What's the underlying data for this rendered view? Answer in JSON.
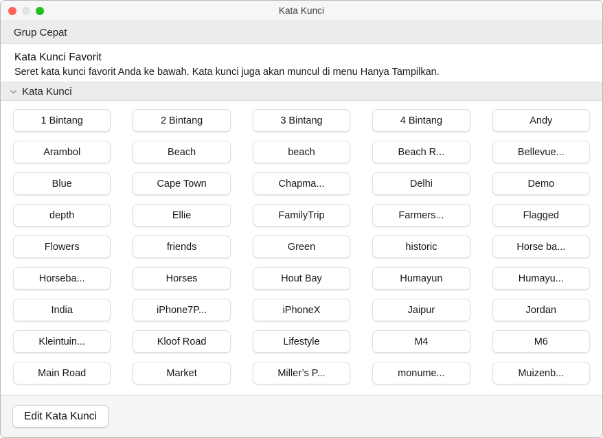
{
  "window": {
    "title": "Kata Kunci",
    "traffic_lights": [
      {
        "name": "close",
        "color": "#ff6159"
      },
      {
        "name": "minimize",
        "color": "#e4e4e4"
      },
      {
        "name": "zoom",
        "color": "#1ec11e"
      }
    ]
  },
  "quick_group": {
    "label": "Grup Cepat"
  },
  "favorites": {
    "title": "Kata Kunci Favorit",
    "description": "Seret kata kunci favorit Anda ke bawah. Kata kunci juga akan muncul di menu Hanya Tampilkan."
  },
  "disclosure": {
    "label": "Kata Kunci",
    "icon": "chevron-down-icon",
    "expanded": true
  },
  "keywords": [
    "1 Bintang",
    "2 Bintang",
    "3 Bintang",
    "4 Bintang",
    "Andy",
    "Arambol",
    "Beach",
    "beach",
    "Beach R...",
    "Bellevue...",
    "Blue",
    "Cape Town",
    "Chapma...",
    "Delhi",
    "Demo",
    "depth",
    "Ellie",
    "FamilyTrip",
    "Farmers...",
    "Flagged",
    "Flowers",
    "friends",
    "Green",
    "historic",
    "Horse ba...",
    "Horseba...",
    "Horses",
    "Hout Bay",
    "Humayun",
    "Humayu...",
    "India",
    "iPhone7P...",
    "iPhoneX",
    "Jaipur",
    "Jordan",
    "Kleintuin...",
    "Kloof Road",
    "Lifestyle",
    "M4",
    "M6",
    "Main Road",
    "Market",
    "Miller’s P...",
    "monume...",
    "Muizenb..."
  ],
  "bottom_bar": {
    "edit_label": "Edit Kata Kunci"
  },
  "colors": {
    "window_bg": "#ffffff",
    "band_bg": "#ececec",
    "titlebar_bg": "#f6f6f6",
    "bottom_bg": "#f5f5f5",
    "chip_border": "#e0e0e0",
    "text": "#161616"
  }
}
